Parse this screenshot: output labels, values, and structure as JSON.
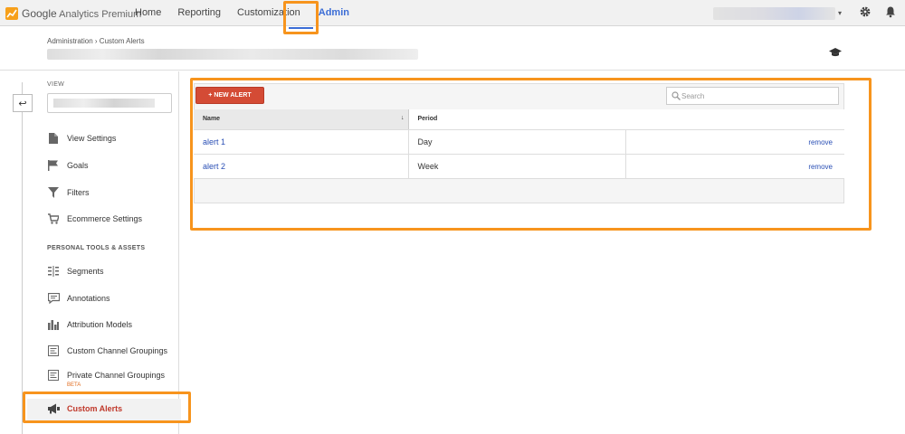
{
  "topbar": {
    "brand": "Google",
    "product": "Analytics Premium",
    "nav": [
      "Home",
      "Reporting",
      "Customization",
      "Admin"
    ],
    "active_nav": "Admin"
  },
  "header": {
    "breadcrumb": "Administration › Custom Alerts"
  },
  "sidebar": {
    "view_label": "VIEW",
    "items": [
      {
        "label": "View Settings",
        "icon": "document-icon"
      },
      {
        "label": "Goals",
        "icon": "flag-icon"
      },
      {
        "label": "Filters",
        "icon": "filter-icon"
      },
      {
        "label": "Ecommerce Settings",
        "icon": "cart-icon"
      }
    ],
    "section_title": "PERSONAL TOOLS & ASSETS",
    "tools": [
      {
        "label": "Segments",
        "icon": "segments-icon"
      },
      {
        "label": "Annotations",
        "icon": "comment-icon"
      },
      {
        "label": "Attribution Models",
        "icon": "bar-chart-icon"
      },
      {
        "label": "Custom Channel Groupings",
        "icon": "channel-grouping-icon"
      },
      {
        "label": "Private Channel Groupings",
        "icon": "channel-grouping-icon",
        "badge": "BETA"
      },
      {
        "label": "Custom Alerts",
        "icon": "megaphone-icon",
        "active": true
      }
    ]
  },
  "main": {
    "new_button": "+ NEW ALERT",
    "search_placeholder": "Search",
    "columns": [
      "Name",
      "Period"
    ],
    "rows": [
      {
        "name": "alert 1",
        "period": "Day",
        "action": "remove"
      },
      {
        "name": "alert 2",
        "period": "Week",
        "action": "remove"
      }
    ]
  },
  "colors": {
    "accent": "#3b6dd6",
    "highlight": "#f7941d",
    "button": "#d44b35",
    "link": "#2a4fb5",
    "beta": "#e06a1c"
  }
}
